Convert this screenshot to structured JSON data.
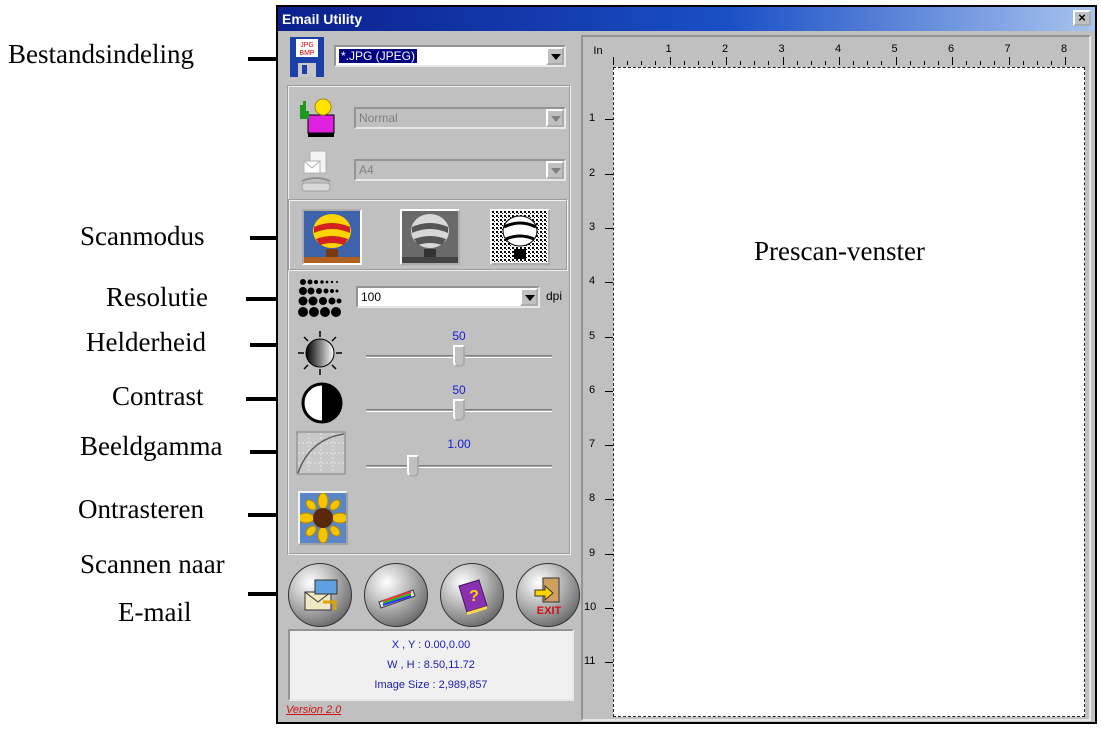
{
  "window": {
    "title": "Email Utility",
    "close_label": "×"
  },
  "callouts": {
    "file_format": "Bestandsindeling",
    "scan_mode": "Scanmodus",
    "resolution": "Resolutie",
    "brightness": "Helderheid",
    "contrast": "Contrast",
    "gamma": "Beeldgamma",
    "descreen": "Ontrasteren",
    "scan_email_1": "Scannen naar",
    "scan_email_2": "E-mail",
    "prescan": "Prescan-venster"
  },
  "file_format": {
    "value": "*.JPG (JPEG)",
    "icon": "jpg-bmp-disk-icon"
  },
  "image_type": {
    "value": "Normal",
    "disabled": true,
    "icon": "image-type-icon"
  },
  "paper_size": {
    "value": "A4",
    "disabled": true,
    "icon": "paper-size-icon"
  },
  "scan_modes": [
    {
      "name": "color",
      "icon": "color-balloon-icon",
      "selected": true
    },
    {
      "name": "gray",
      "icon": "gray-balloon-icon",
      "selected": false
    },
    {
      "name": "lineart",
      "icon": "lineart-balloon-icon",
      "selected": false
    }
  ],
  "resolution": {
    "value": "100",
    "unit": "dpi"
  },
  "brightness": {
    "value": "50",
    "fraction": 0.5
  },
  "contrast": {
    "value": "50",
    "fraction": 0.5
  },
  "gamma": {
    "value": "1.00",
    "fraction": 0.25
  },
  "descreen": {
    "icon": "sunflower-icon"
  },
  "action_buttons": [
    {
      "name": "scan-to-email",
      "icon": "scan-email-icon"
    },
    {
      "name": "prescan",
      "icon": "scanner-icon"
    },
    {
      "name": "help",
      "icon": "help-book-icon"
    },
    {
      "name": "exit",
      "icon": "exit-icon",
      "label": "EXIT"
    }
  ],
  "status": {
    "xy": "X , Y : 0.00,0.00",
    "wh": "W , H : 8.50,11.72",
    "image_size": "Image Size : 2,989,857"
  },
  "version": "Version 2.0",
  "ruler": {
    "unit": "In",
    "h_ticks": [
      "1",
      "2",
      "3",
      "4",
      "5",
      "6",
      "7",
      "8"
    ],
    "v_ticks": [
      "1",
      "2",
      "3",
      "4",
      "5",
      "6",
      "7",
      "8",
      "9",
      "10",
      "11"
    ]
  },
  "colors": {
    "title_start": "#0a1f8c",
    "title_end": "#a7c3ee",
    "slider_value": "#1a1adc",
    "version": "#d01010"
  }
}
